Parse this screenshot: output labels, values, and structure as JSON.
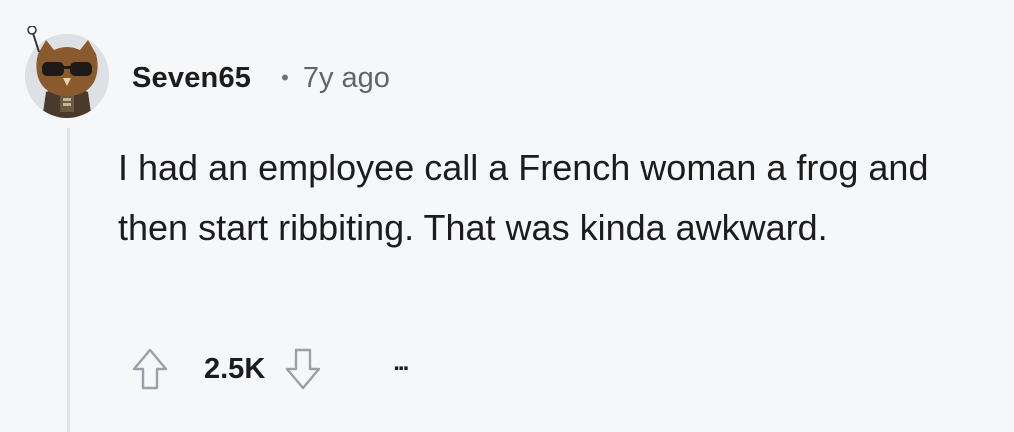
{
  "comment": {
    "username": "Seven65",
    "separator": "•",
    "timestamp": "7y ago",
    "body": "I had an employee call a French woman a frog and then start ribbiting. That was kinda awkward.",
    "score": "2.5K",
    "more": "..."
  },
  "icons": {
    "avatar": "owl-avatar-icon",
    "upvote": "upvote-arrow-icon",
    "downvote": "downvote-arrow-icon",
    "more": "more-options-icon"
  },
  "colors": {
    "background": "#f6f7f9",
    "text": "#1c1c1c",
    "muted": "#5e666d",
    "thread_line": "#dfe3e8",
    "vote_icon": "#9aa0a6"
  }
}
